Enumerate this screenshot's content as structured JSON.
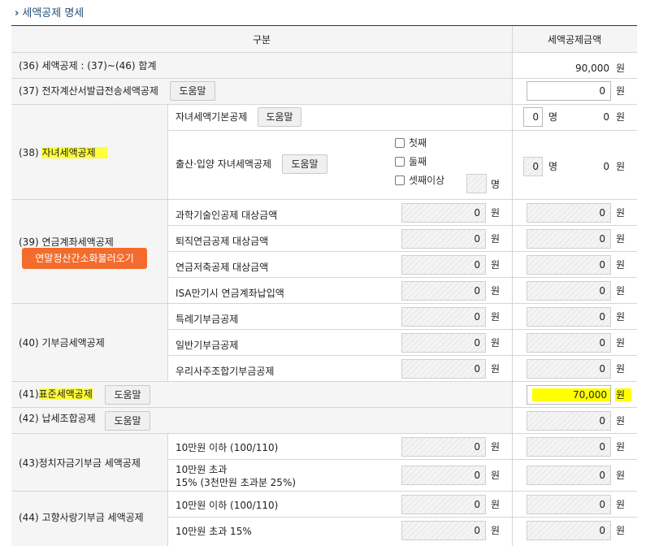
{
  "title": "세액공제 명세",
  "header": {
    "col1": "구분",
    "col2": "세액공제금액"
  },
  "unit_won": "원",
  "unit_person": "명",
  "help_label": "도움말",
  "rows": {
    "r36": {
      "label": "(36) 세액공제 : (37)~(46) 합계",
      "amount": "90,000"
    },
    "r37": {
      "label": "(37) 전자계산서발급전송세액공제",
      "amount": "0"
    },
    "r38": {
      "label_prefix": "(38)",
      "label_main": "자녀세액공제",
      "basic_label": "자녀세액기본공제",
      "basic_count": "0",
      "basic_amount": "0",
      "birth_label": "출산·입양 자녀세액공제",
      "options": [
        "첫째",
        "둘째",
        "셋째이상"
      ],
      "birth_count": "0",
      "birth_amount": "0"
    },
    "r39": {
      "label": "(39) 연금계좌세액공제",
      "import_button": "연말정산간소화불러오기",
      "items": [
        {
          "label": "과학기술인공제 대상금액",
          "base": "0",
          "amount": "0"
        },
        {
          "label": "퇴직연금공제 대상금액",
          "base": "0",
          "amount": "0"
        },
        {
          "label": "연금저축공제 대상금액",
          "base": "0",
          "amount": "0"
        },
        {
          "label": "ISA만기시 연금계좌납입액",
          "base": "0",
          "amount": "0"
        }
      ]
    },
    "r40": {
      "label": "(40) 기부금세액공제",
      "items": [
        {
          "label": "특례기부금공제",
          "base": "0",
          "amount": "0"
        },
        {
          "label": "일반기부금공제",
          "base": "0",
          "amount": "0"
        },
        {
          "label": "우리사주조합기부금공제",
          "base": "0",
          "amount": "0"
        }
      ]
    },
    "r41": {
      "label_prefix": "(41)",
      "label_main": "표준세액공제",
      "amount": "70,000"
    },
    "r42": {
      "label": "(42) 납세조합공제",
      "amount": "0"
    },
    "r43": {
      "label": "(43)정치자금기부금 세액공제",
      "items": [
        {
          "label": "10만원 이하 (100/110)",
          "base": "0",
          "amount": "0"
        },
        {
          "label": "10만원 초과",
          "label2": "15% (3천만원 초과분 25%)",
          "base": "0",
          "amount": "0"
        }
      ]
    },
    "r44": {
      "label": "(44) 고향사랑기부금 세액공제",
      "items": [
        {
          "label": "10만원 이하 (100/110)",
          "base": "0",
          "amount": "0"
        },
        {
          "label": "10만원 초과 15%",
          "base": "0",
          "amount": "0"
        }
      ]
    }
  }
}
